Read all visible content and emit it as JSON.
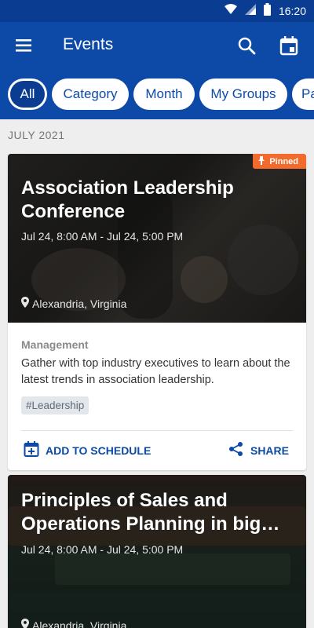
{
  "status_bar": {
    "time": "16:20",
    "icons": [
      "wifi-icon",
      "signal-icon",
      "battery-icon"
    ]
  },
  "app_bar": {
    "title": "Events",
    "icons": [
      "menu-icon",
      "search-icon",
      "calendar-icon"
    ]
  },
  "filters": {
    "chips": [
      {
        "label": "All",
        "active": true
      },
      {
        "label": "Category",
        "active": false
      },
      {
        "label": "Month",
        "active": false
      },
      {
        "label": "My Groups",
        "active": false
      },
      {
        "label": "Pa",
        "active": false
      }
    ]
  },
  "section": {
    "header": "JULY 2021"
  },
  "events": [
    {
      "pinned_label": "Pinned",
      "title": "Association Leadership Conference",
      "date": "Jul 24, 8:00 AM - Jul 24, 5:00 PM",
      "location": "Alexandria, Virginia",
      "category": "Management",
      "description": "Gather with top industry executives to learn about the latest trends in association leadership.",
      "tag": "#Leadership",
      "add_label": "ADD TO SCHEDULE",
      "share_label": "SHARE"
    },
    {
      "title": "Principles of Sales and Operations Planning in big…",
      "date": "Jul 24, 8:00 AM - Jul 24, 5:00 PM",
      "location": "Alexandria, Virginia"
    }
  ],
  "colors": {
    "primary": "#0d4aa8",
    "status_bar": "#0a3d91",
    "pinned": "#f26a2c",
    "background": "#eeeeee"
  }
}
